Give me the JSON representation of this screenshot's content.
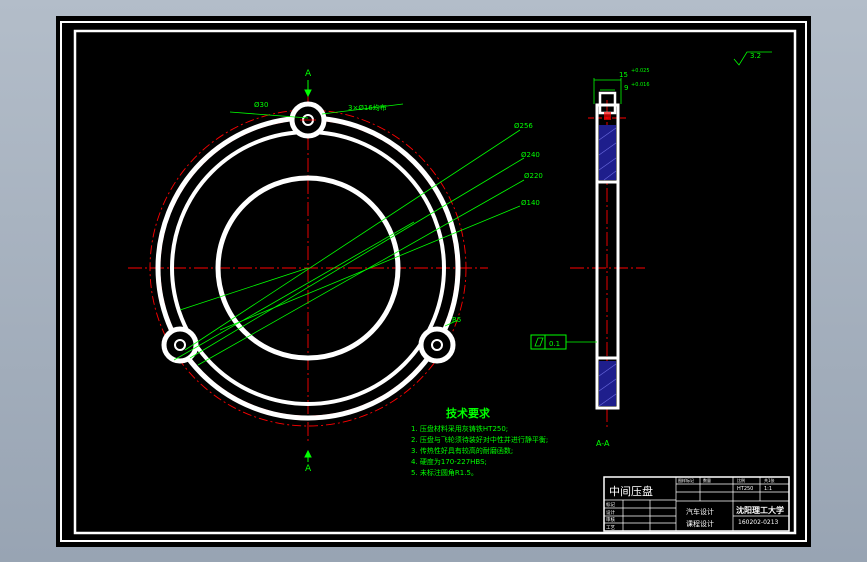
{
  "colors": {
    "background": "#000000",
    "frame": "#ffffff",
    "part": "#ffffff",
    "centerline": "#ff0000",
    "dimension": "#00ff00",
    "section_fill": "#1e1e8c",
    "title_text": "#ffffff"
  },
  "section_marks": {
    "top": "A",
    "bottom": "A",
    "view_label": "A-A"
  },
  "dimensions": {
    "hole_dia": "Ø30",
    "bolt_holes": "3×Ø16均布",
    "d256": "Ø256",
    "d240": "Ø240",
    "d220": "Ø220",
    "d140": "Ø140",
    "radius": "R5",
    "thickness_15": "15",
    "tol_15": "+0.025",
    "thickness_9": "9",
    "tol_9": "+0.016",
    "flatness": "0.1",
    "roughness": "3.2"
  },
  "notes": {
    "title": "技术要求",
    "items": [
      "1. 压盘材料采用灰铸铁HT250;",
      "2. 压盘与飞轮须待装好对中性并进行静平衡;",
      "3. 传热性好具有较高的耐磨函数;",
      "4. 硬度为170-227HBS;",
      "5. 未标注圆角R1.5。"
    ]
  },
  "title_block": {
    "part_name": "中间压盘",
    "course": "汽车设计",
    "course2": "课程设计",
    "school": "沈阳理工大学",
    "drawing_no": "160202-0213",
    "material": "HT250",
    "scale": "1:1",
    "row_labels": [
      "标记",
      "设计",
      "审核",
      "工艺"
    ],
    "col_labels": [
      "图样标记",
      "数量",
      "比例",
      "共1张"
    ]
  }
}
